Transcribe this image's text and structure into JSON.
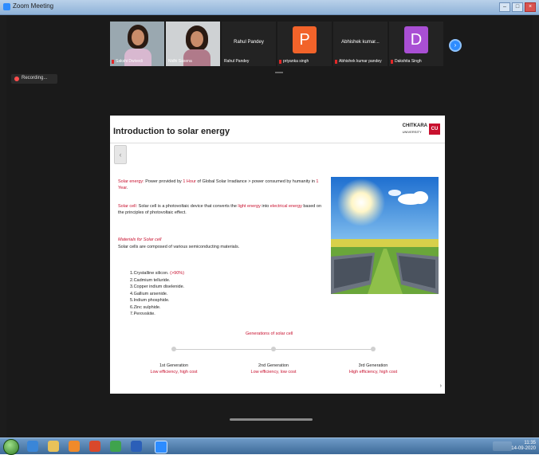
{
  "window": {
    "title": "Zoom Meeting"
  },
  "recording": {
    "label": "Recording..."
  },
  "participants": [
    {
      "name": "Sakshi Dwivedi"
    },
    {
      "name": "Nidhi Saxena"
    },
    {
      "name": "Rahul Pandey",
      "display": "Rahul Pandey"
    },
    {
      "name": "priyanka singh",
      "initial": "P",
      "color": "#f2632a"
    },
    {
      "name": "Abhishek kumar pandey",
      "display": "Abhishek kumar...",
      "initial": "",
      "color": ""
    },
    {
      "name": "Dakshita Singh",
      "initial": "D",
      "color": "#a94fd4"
    }
  ],
  "slide": {
    "title": "Introduction to solar energy",
    "logo": {
      "line1": "CHITKARA",
      "line2": "UNIVERSITY",
      "badge": "CU"
    },
    "p1": {
      "term": "Solar energy:",
      "a": " Power provided by ",
      "hl1": "1 Hour",
      "b": " of Global Solar Irradiance > power consumed by humanity in ",
      "hl2": "1 Year",
      "c": "."
    },
    "p2": {
      "term": "Solar cell:",
      "a": " Solar cell is a photovoltaic device that converts the ",
      "hl1": "light energy",
      "b": " into ",
      "hl2": "electrical energy",
      "c": " based on the principles of photovoltaic effect."
    },
    "materials_heading": "Materials for Solar cell",
    "materials_intro": "Solar cells are composed of various semiconducting materials.",
    "materials": [
      {
        "text": "1.Crystalline silicon. ",
        "note": "(>90%)"
      },
      {
        "text": "2.Cadmium telluride.",
        "note": ""
      },
      {
        "text": "3.Copper indium diselenide.",
        "note": ""
      },
      {
        "text": "4.Gallium arsenide.",
        "note": ""
      },
      {
        "text": "5.Indium phosphide.",
        "note": ""
      },
      {
        "text": "6.Zinc sulphide.",
        "note": ""
      },
      {
        "text": "7.Perovskite.",
        "note": ""
      }
    ],
    "generations_heading": "Generations of solar cell",
    "generations": [
      {
        "name": "1st Generation",
        "desc": "Low efficiency, high cost"
      },
      {
        "name": "2nd Generation",
        "desc": "Low efficiency, low cost"
      },
      {
        "name": "3rd Generation",
        "desc": "High efficiency, high cost"
      }
    ]
  },
  "taskbar": {
    "time": "11:35",
    "date": "14-09-2020"
  },
  "colors": {
    "accent_red": "#c8102e",
    "zoom_blue": "#2d8cff"
  }
}
